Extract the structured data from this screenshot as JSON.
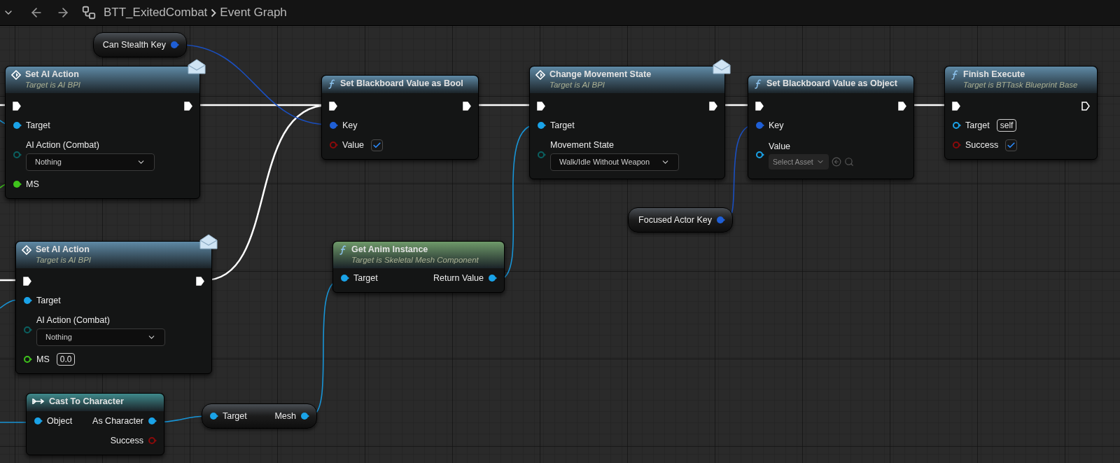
{
  "toolbar": {
    "breadcrumb": [
      "BTT_ExitedCombat",
      "Event Graph"
    ]
  },
  "nodes": [
    {
      "kind": "variable",
      "rows": [
        {
          "out": {
            "kind": "data",
            "label": "Can Stealth Key",
            "color": "#1f5fd6",
            "connected": true
          }
        }
      ]
    },
    {
      "kind": "event",
      "title": "Set AI Action",
      "subtitle": "Target is AI BPI",
      "color": "#5f8aa6",
      "message": true,
      "rows": [
        {
          "in": {
            "kind": "exec",
            "connected": true
          },
          "out": {
            "kind": "exec",
            "connected": true
          }
        },
        {
          "in": {
            "kind": "data",
            "label": "Target",
            "color": "#1aa3e8",
            "connected": true
          }
        },
        {
          "in": {
            "kind": "data",
            "label": "AI Action (Combat)",
            "color": "#0b6060",
            "connected": false,
            "dropdown": "Nothing"
          }
        },
        {
          "in": {
            "kind": "data",
            "label": "MS",
            "color": "#3fc41c",
            "connected": true
          }
        }
      ]
    },
    {
      "kind": "function",
      "title": "Set Blackboard Value as Bool",
      "color": "#5f8aa6",
      "message": false,
      "rows": [
        {
          "in": {
            "kind": "exec",
            "connected": true
          },
          "out": {
            "kind": "exec",
            "connected": true
          }
        },
        {
          "in": {
            "kind": "data",
            "label": "Key",
            "color": "#1f5fd6",
            "connected": true
          }
        },
        {
          "in": {
            "kind": "data",
            "label": "Value",
            "color": "#8b0a0a",
            "connected": false,
            "checked": true
          }
        }
      ]
    },
    {
      "kind": "event",
      "title": "Change Movement State",
      "subtitle": "Target is AI BPI",
      "color": "#5f8aa6",
      "message": true,
      "rows": [
        {
          "in": {
            "kind": "exec",
            "connected": true
          },
          "out": {
            "kind": "exec",
            "connected": true
          }
        },
        {
          "in": {
            "kind": "data",
            "label": "Target",
            "color": "#1aa3e8",
            "connected": true
          }
        },
        {
          "in": {
            "kind": "data",
            "label": "Movement State",
            "color": "#0b6060",
            "connected": false,
            "dropdown": "Walk/Idle Without Weapon"
          }
        }
      ]
    },
    {
      "kind": "function",
      "title": "Set Blackboard Value as Object",
      "color": "#5f8aa6",
      "message": false,
      "rows": [
        {
          "in": {
            "kind": "exec",
            "connected": true
          },
          "out": {
            "kind": "exec",
            "connected": true
          }
        },
        {
          "in": {
            "kind": "data",
            "label": "Key",
            "color": "#1f5fd6",
            "connected": true
          }
        },
        {
          "in": {
            "kind": "data",
            "label": "Value",
            "color": "#1aa3e8",
            "connected": false,
            "picker": "Select Asset"
          }
        }
      ]
    },
    {
      "kind": "function",
      "title": "Finish Execute",
      "subtitle": "Target is BTTask Blueprint Base",
      "color": "#5f8aa6",
      "message": false,
      "rows": [
        {
          "in": {
            "kind": "exec",
            "connected": true
          },
          "out": {
            "kind": "exec",
            "connected": false
          }
        },
        {
          "in": {
            "kind": "data",
            "label": "Target",
            "color": "#1aa3e8",
            "connected": false,
            "value": "self"
          }
        },
        {
          "in": {
            "kind": "data",
            "label": "Success",
            "color": "#8b0a0a",
            "connected": false,
            "checked": true
          }
        }
      ]
    },
    {
      "kind": "variable",
      "rows": [
        {
          "out": {
            "kind": "data",
            "label": "Focused Actor Key",
            "color": "#1f5fd6",
            "connected": true
          }
        }
      ]
    },
    {
      "kind": "event",
      "title": "Set AI Action",
      "subtitle": "Target is AI BPI",
      "color": "#5f8aa6",
      "message": true,
      "rows": [
        {
          "in": {
            "kind": "exec",
            "connected": true
          },
          "out": {
            "kind": "exec",
            "connected": true
          }
        },
        {
          "in": {
            "kind": "data",
            "label": "Target",
            "color": "#1aa3e8",
            "connected": true
          }
        },
        {
          "in": {
            "kind": "data",
            "label": "AI Action (Combat)",
            "color": "#0b6060",
            "connected": false,
            "dropdown": "Nothing"
          }
        },
        {
          "in": {
            "kind": "data",
            "label": "MS",
            "color": "#3fc41c",
            "connected": false,
            "value": "0.0"
          }
        }
      ]
    },
    {
      "kind": "function",
      "title": "Get Anim Instance",
      "subtitle": "Target is Skeletal Mesh Component",
      "color": "#6f9a6a",
      "message": false,
      "rows": [
        {
          "in": {
            "kind": "data",
            "label": "Target",
            "color": "#1aa3e8",
            "connected": true
          },
          "out": {
            "kind": "data",
            "label": "Return Value",
            "color": "#1aa3e8",
            "connected": true
          }
        }
      ]
    },
    {
      "kind": "cast",
      "title": "Cast To Character",
      "color": "#3f8a8c",
      "message": false,
      "rows": [
        {
          "in": {
            "kind": "data",
            "label": "Object",
            "color": "#1aa3e8",
            "connected": true
          },
          "out": {
            "kind": "data",
            "label": "As Character",
            "color": "#1aa3e8",
            "connected": true
          }
        },
        {
          "out": {
            "kind": "data",
            "label": "Success",
            "color": "#8b0a0a",
            "connected": false
          }
        }
      ]
    },
    {
      "kind": "variable",
      "rows": [
        {
          "in": {
            "kind": "data",
            "label": "Target",
            "color": "#1aa3e8",
            "connected": true
          },
          "out": {
            "kind": "data",
            "label": "Mesh",
            "color": "#1aa3e8",
            "connected": true
          }
        }
      ]
    }
  ]
}
